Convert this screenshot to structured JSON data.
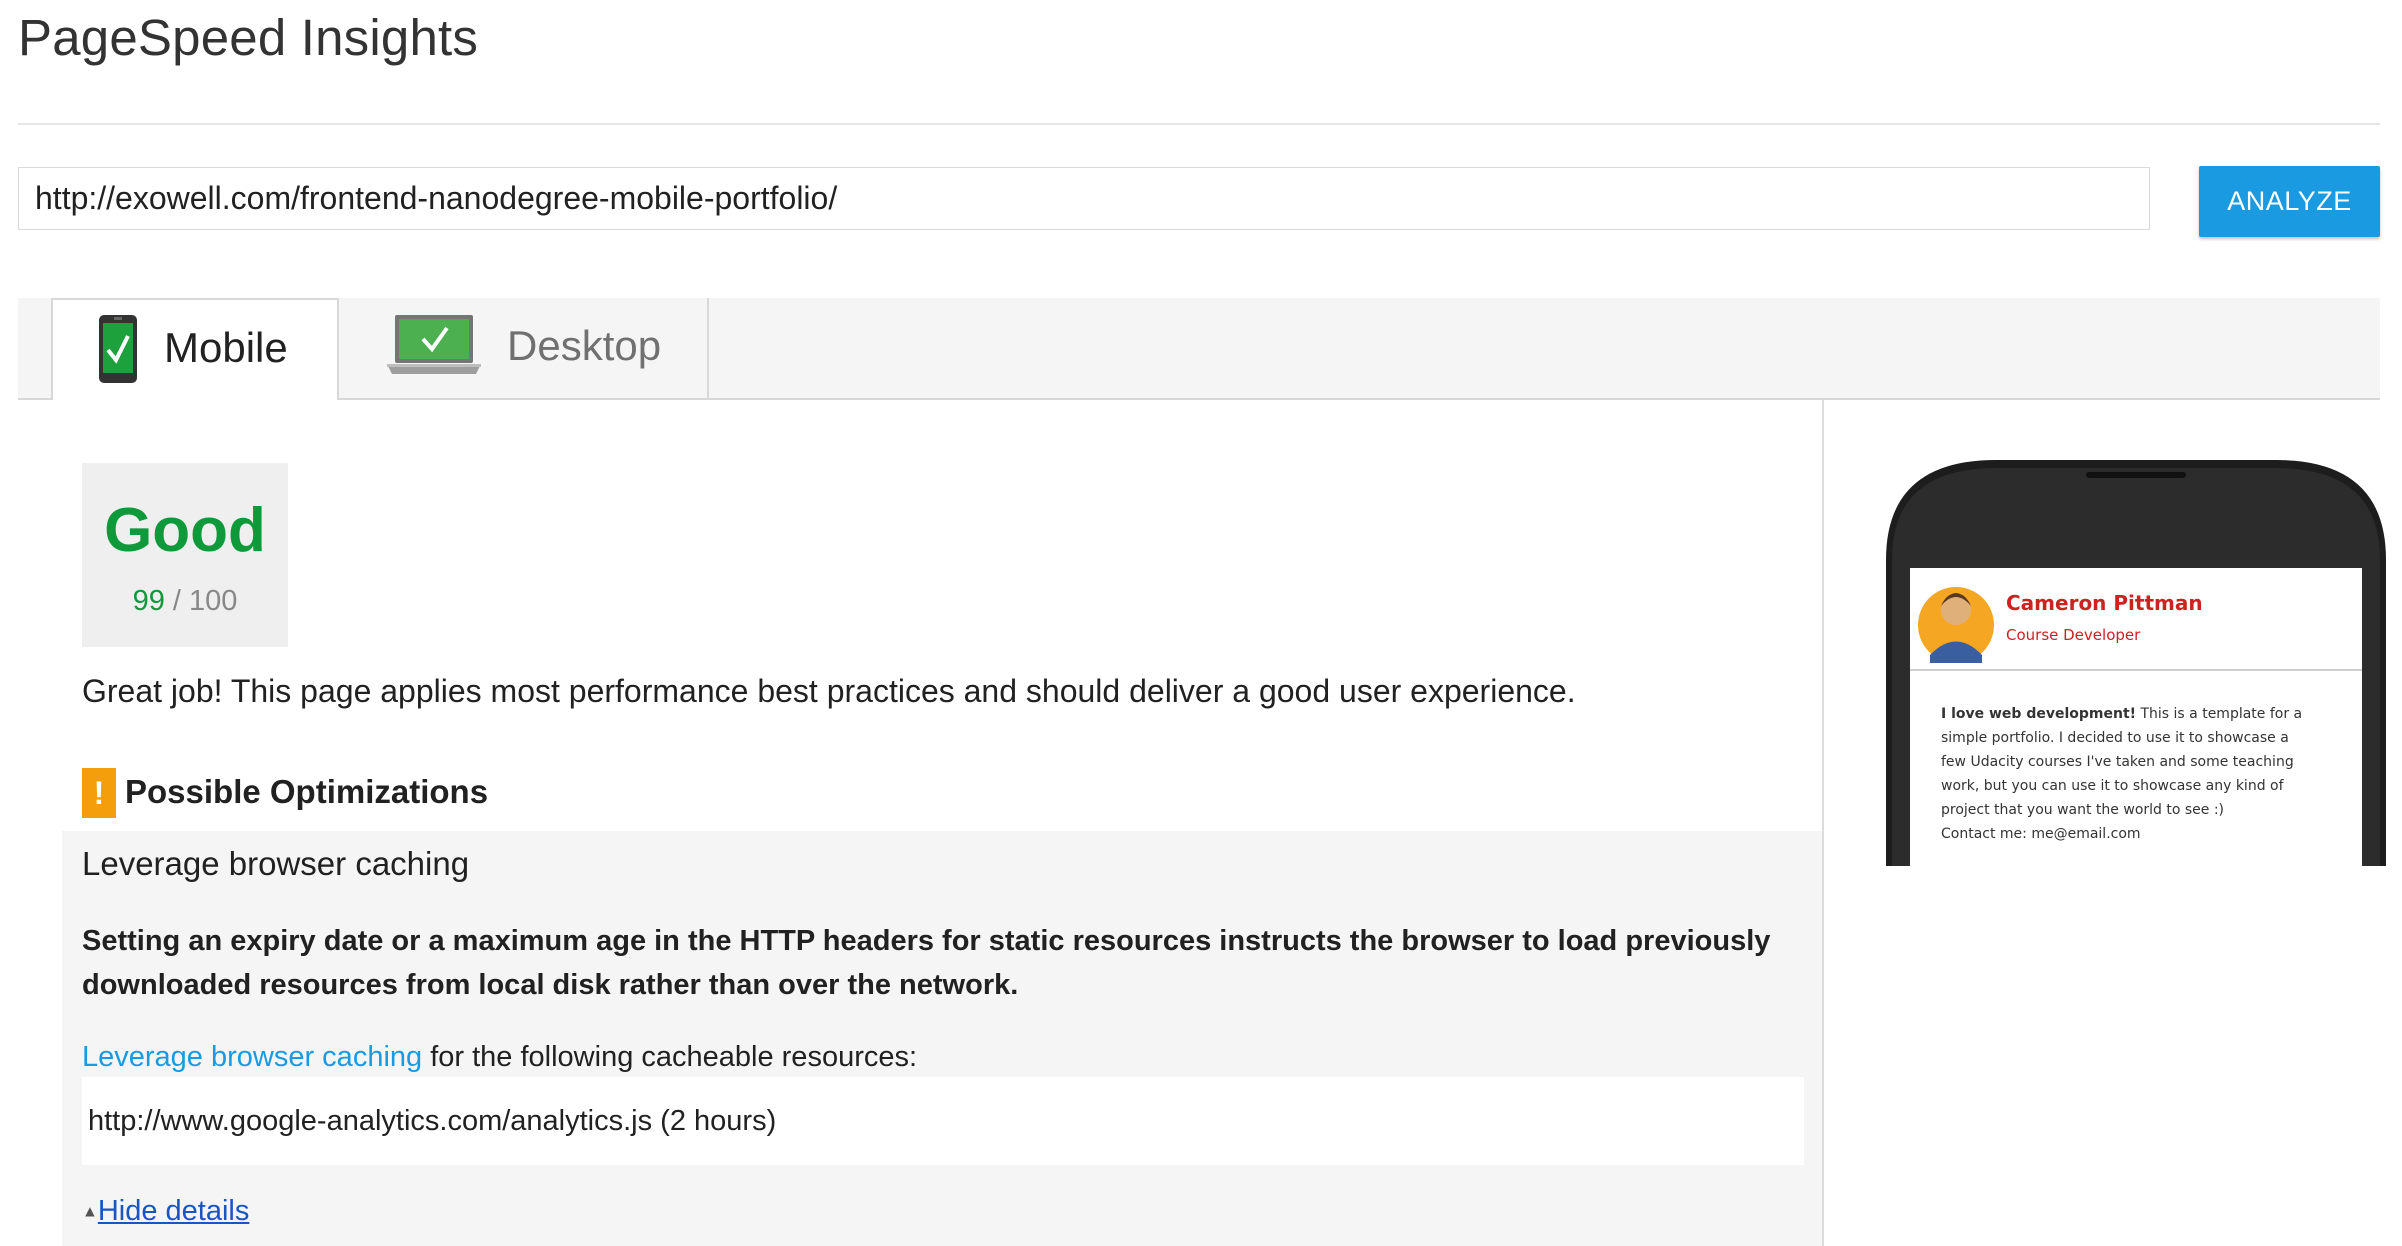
{
  "header": {
    "title": "PageSpeed Insights"
  },
  "search": {
    "url": "http://exowell.com/frontend-nanodegree-mobile-portfolio/",
    "analyze_label": "ANALYZE"
  },
  "tabs": [
    {
      "label": "Mobile",
      "icon": "mobile-check-icon",
      "active": true
    },
    {
      "label": "Desktop",
      "icon": "desktop-check-icon",
      "active": false
    }
  ],
  "score": {
    "rating": "Good",
    "value": "99",
    "max": "/ 100",
    "color": "#0e9a3b"
  },
  "summary": "Great job! This page applies most performance best practices and should deliver a good user experience.",
  "optimizations": {
    "badge": "!",
    "heading": "Possible Optimizations",
    "rule": {
      "name": "Leverage browser caching",
      "description": "Setting an expiry date or a maximum age in the HTTP headers for static resources instructs the browser to load previously downloaded resources from local disk rather than over the network.",
      "link_text": "Leverage browser caching",
      "line_rest": " for the following cacheable resources:",
      "resources": [
        "http://www.google-analytics.com/analytics.js (2 hours)"
      ],
      "toggle_label": "Hide details"
    }
  },
  "preview": {
    "name": "Cameron Pittman",
    "role": "Course Developer",
    "body_bold": "I love web development!",
    "body_lines": [
      " This is a template for a",
      "simple portfolio. I decided to use it to showcase a",
      "few Udacity courses I've taken and some teaching",
      "work, but you can use it to showcase any kind of",
      "project that you want the world to see :)"
    ],
    "contact": "Contact me: me@email.com"
  },
  "colors": {
    "accent": "#1a9be1",
    "good": "#0e9a3b",
    "warning": "#f59e0b",
    "preview_red": "#cc2222"
  }
}
